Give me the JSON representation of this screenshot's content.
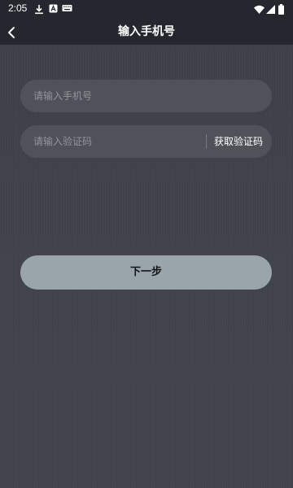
{
  "status_bar": {
    "time": "2:05",
    "left_icons": [
      "download-icon",
      "notification-a-icon",
      "keyboard-icon"
    ],
    "right_icons": [
      "wifi-icon",
      "cell-signal-icon",
      "battery-icon"
    ]
  },
  "header": {
    "title": "输入手机号",
    "back_icon": "chevron-left-icon"
  },
  "form": {
    "phone_placeholder": "请输入手机号",
    "code_placeholder": "请输入验证码",
    "get_code_label": "获取验证码",
    "next_label": "下一步"
  },
  "colors": {
    "bar_background": "#25272e",
    "page_background": "#41434b",
    "field_background": "#50525a",
    "button_background": "#9aa4ab"
  }
}
